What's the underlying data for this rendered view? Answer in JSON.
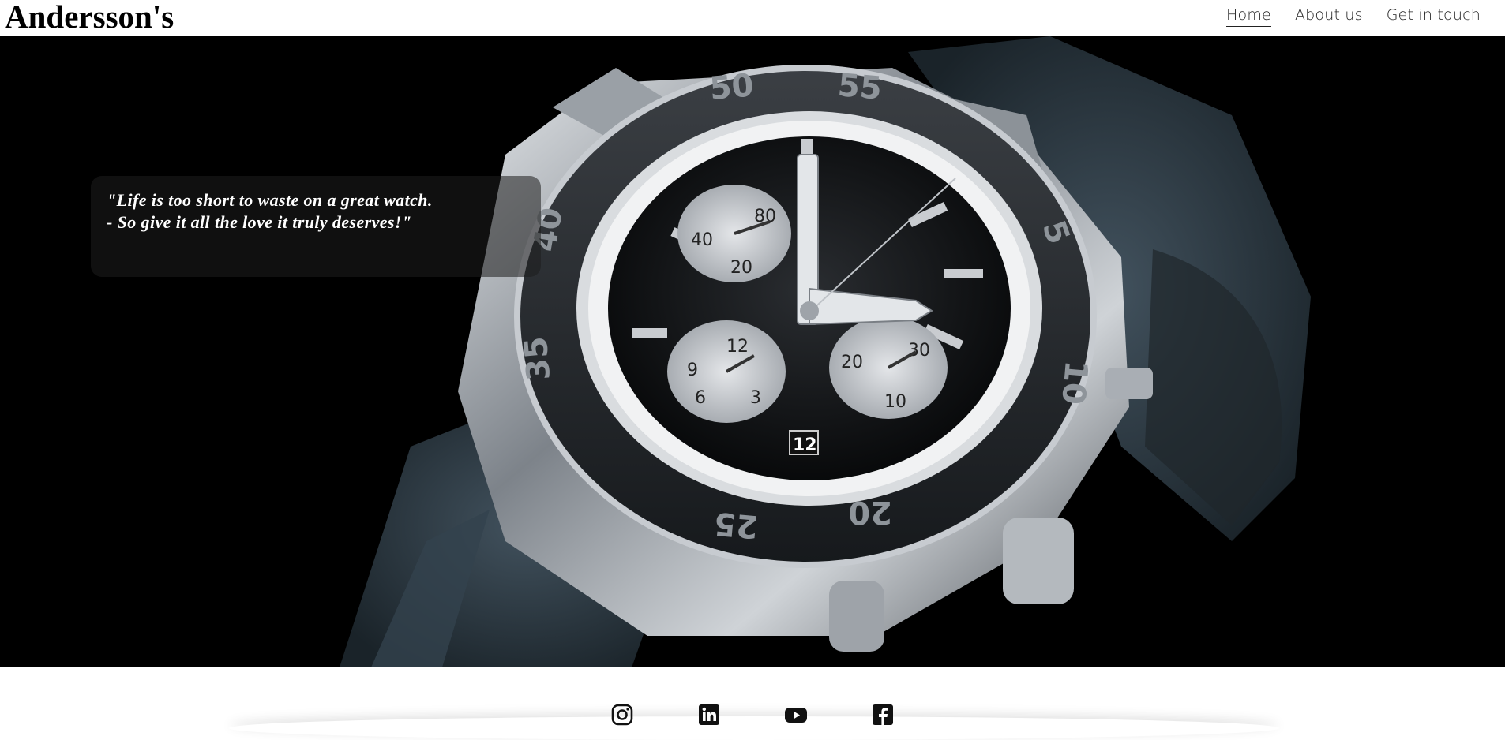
{
  "brand": {
    "name": "Andersson's"
  },
  "nav": {
    "items": [
      {
        "label": "Home",
        "active": true
      },
      {
        "label": "About us",
        "active": false
      },
      {
        "label": "Get in touch",
        "active": false
      }
    ]
  },
  "hero": {
    "quote_line1": "\"Life is too short to waste on a great watch.",
    "quote_line2": "- So give it all the love it truly deserves!\"",
    "watch_bezel_numbers": [
      "50",
      "55",
      "5",
      "10",
      "20",
      "25",
      "35",
      "40"
    ],
    "watch_date": "12",
    "subdial_left_top": [
      "80",
      "40",
      "20"
    ],
    "subdial_bottom_left": [
      "12",
      "9",
      "6",
      "3"
    ],
    "subdial_bottom_right": [
      "30",
      "20",
      "10"
    ]
  },
  "social": {
    "icons": [
      "instagram-icon",
      "linkedin-icon",
      "youtube-icon",
      "facebook-icon"
    ]
  },
  "colors": {
    "hero_bg": "#000000",
    "strap": "#2e3b45",
    "steel": "#b8bcc2"
  }
}
